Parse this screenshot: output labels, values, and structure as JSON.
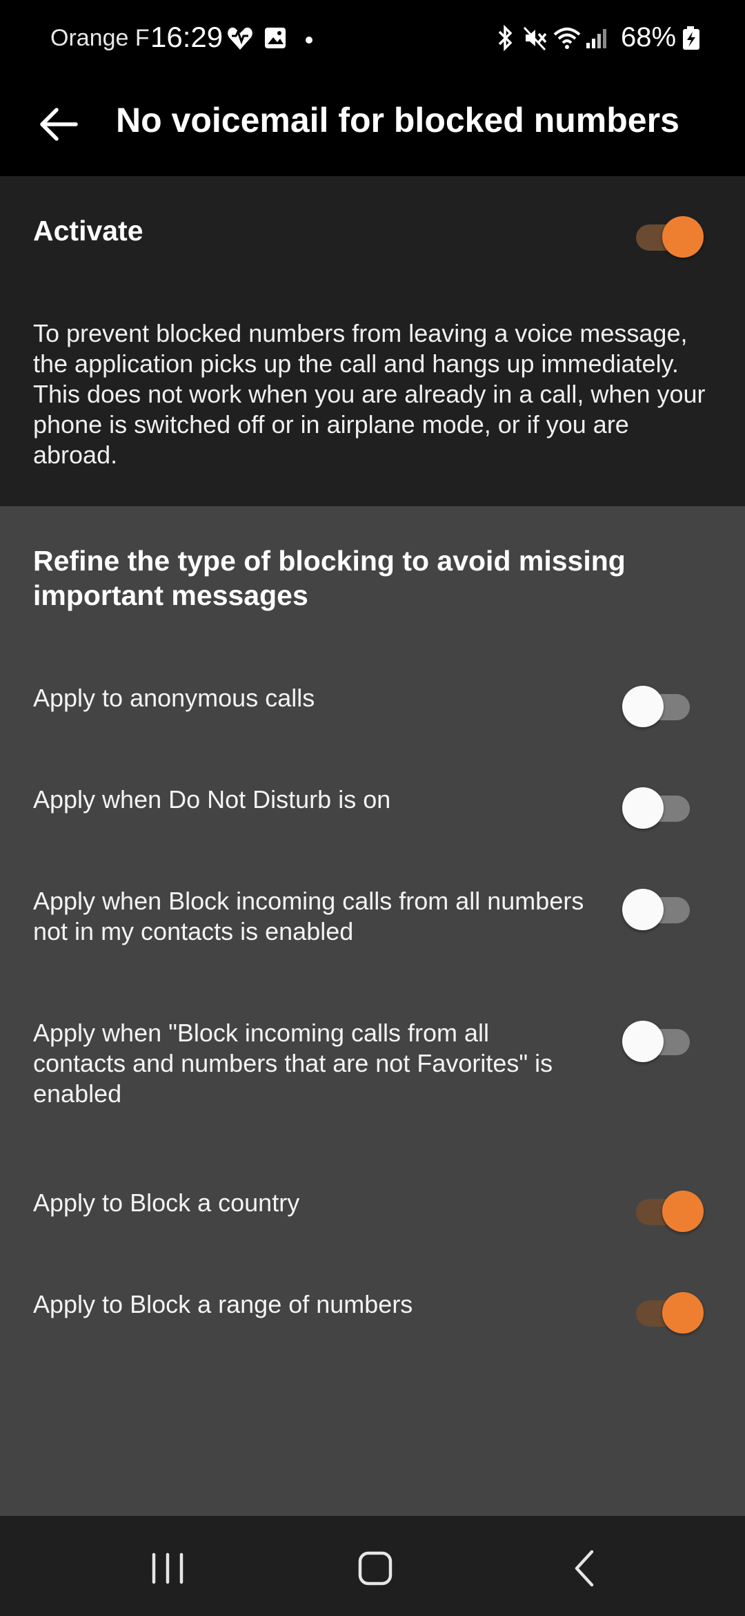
{
  "status_bar": {
    "carrier": "Orange F",
    "time": "16:29",
    "battery": "68%",
    "icons": [
      "health-icon",
      "gallery-icon",
      "notification-dot-icon",
      "bluetooth-icon",
      "mute-icon",
      "wifi-icon",
      "signal-icon",
      "battery-charging-icon"
    ]
  },
  "app_bar": {
    "title": "No voicemail for blocked numbers",
    "back_icon": "arrow-left-icon"
  },
  "activate": {
    "label": "Activate",
    "enabled": true,
    "description": "To prevent blocked numbers from leaving a voice message, the application picks up the call and hangs up immediately. This does not work when you are already in a call, when your phone is switched off or in airplane mode, or if you are abroad."
  },
  "refine": {
    "title": "Refine the type of blocking to avoid missing important messages",
    "options": [
      {
        "label": "Apply to anonymous calls",
        "enabled": false
      },
      {
        "label": "Apply when Do Not Disturb is on",
        "enabled": false
      },
      {
        "label": "Apply when Block incoming calls from all numbers not in my contacts is enabled",
        "enabled": false
      },
      {
        "label": "Apply when \"Block incoming calls from all contacts and numbers that are not Favorites\" is enabled",
        "enabled": false
      },
      {
        "label": "Apply to Block a country",
        "enabled": true
      },
      {
        "label": "Apply to Block a range of numbers",
        "enabled": true
      }
    ]
  },
  "nav_bar": {
    "icons": [
      "recents-icon",
      "home-icon",
      "back-icon"
    ]
  },
  "colors": {
    "accent": "#ef7f30",
    "accent_track": "#6a4a30",
    "background_dark": "#202021",
    "background_section": "#444445"
  }
}
